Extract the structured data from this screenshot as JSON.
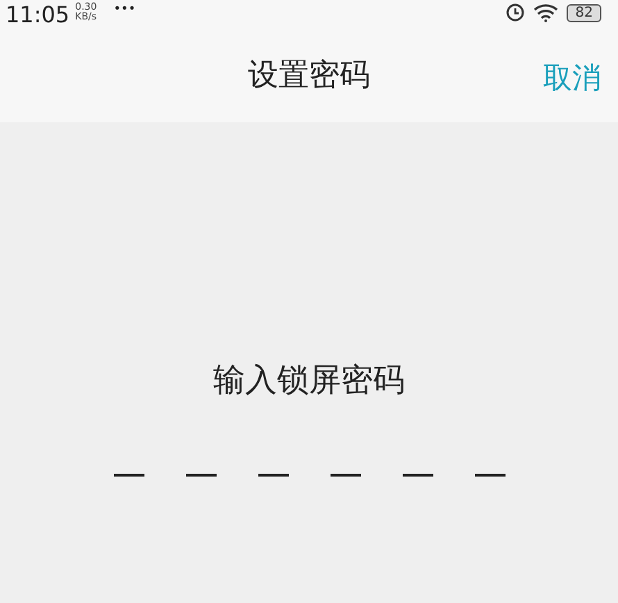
{
  "status_bar": {
    "time": "11:05",
    "speed_value": "0.30",
    "speed_unit": "KB/s",
    "more": "•••",
    "battery": "82"
  },
  "header": {
    "title": "设置密码",
    "cancel": "取消"
  },
  "prompt": "输入锁屏密码",
  "pin_slots": [
    {
      "filled": false
    },
    {
      "filled": false
    },
    {
      "filled": false
    },
    {
      "filled": false
    },
    {
      "filled": false
    },
    {
      "filled": false
    }
  ]
}
